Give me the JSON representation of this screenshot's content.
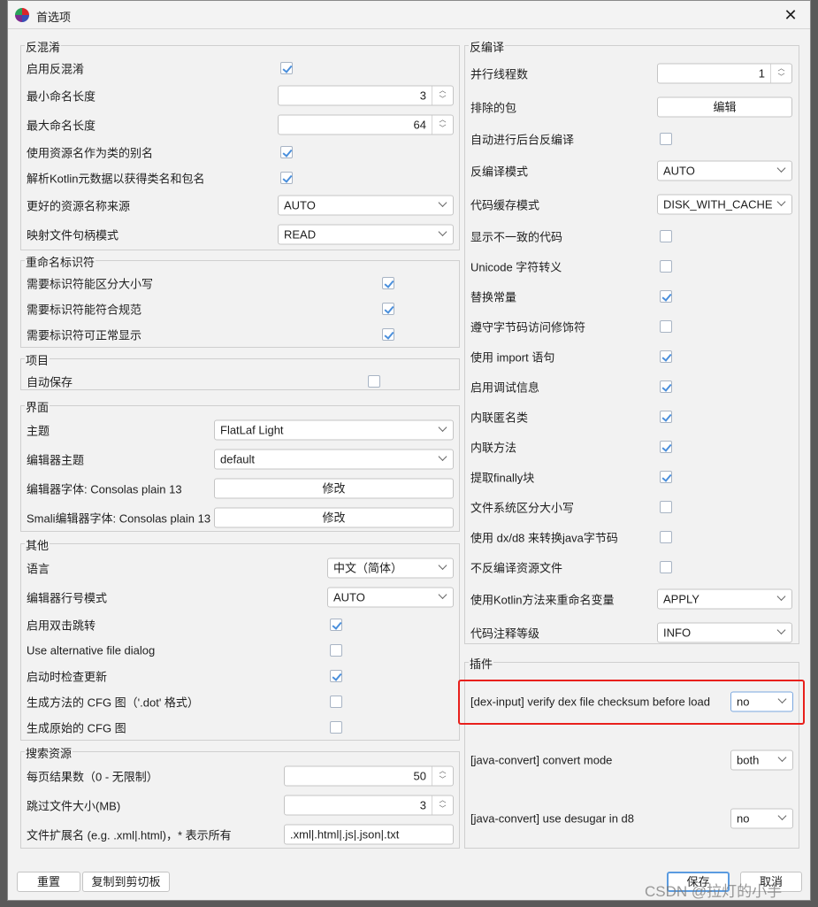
{
  "window": {
    "title": "首选项",
    "close_icon": "close-icon",
    "app_icon": "jadx-logo-icon"
  },
  "accent_color": "#4a8fdc",
  "highlight_color": "#e8201c",
  "groups": [
    {
      "id": "deobfuscation",
      "title": "反混淆",
      "rows": [
        {
          "label": "启用反混淆",
          "type": "check",
          "checked": true
        },
        {
          "label": "最小命名长度",
          "type": "spin",
          "value": "3"
        },
        {
          "label": "最大命名长度",
          "type": "spin",
          "value": "64"
        },
        {
          "label": "使用资源名作为类的别名",
          "type": "check",
          "checked": true
        },
        {
          "label": "解析Kotlin元数据以获得类名和包名",
          "type": "check",
          "checked": true
        },
        {
          "label": "更好的资源名称来源",
          "type": "select",
          "value": "AUTO"
        },
        {
          "label": "映射文件句柄模式",
          "type": "select",
          "value": "READ"
        }
      ]
    },
    {
      "id": "rename",
      "title": "重命名标识符",
      "rows": [
        {
          "label": "需要标识符能区分大小写",
          "type": "check",
          "checked": true
        },
        {
          "label": "需要标识符能符合规范",
          "type": "check",
          "checked": true
        },
        {
          "label": "需要标识符可正常显示",
          "type": "check",
          "checked": true
        }
      ]
    },
    {
      "id": "project",
      "title": "项目",
      "rows": [
        {
          "label": "自动保存",
          "type": "check",
          "checked": false
        }
      ]
    },
    {
      "id": "ui",
      "title": "界面",
      "rows": [
        {
          "label": "主题",
          "type": "select",
          "value": "FlatLaf Light"
        },
        {
          "label": "编辑器主题",
          "type": "select",
          "value": "default"
        },
        {
          "label": "编辑器字体: Consolas plain 13",
          "type": "button",
          "value": "修改"
        },
        {
          "label": "Smali编辑器字体: Consolas plain 13",
          "type": "button",
          "value": "修改"
        }
      ]
    },
    {
      "id": "other",
      "title": "其他",
      "rows": [
        {
          "label": "语言",
          "type": "select",
          "value": "中文（简体）"
        },
        {
          "label": "编辑器行号模式",
          "type": "select",
          "value": "AUTO"
        },
        {
          "label": "启用双击跳转",
          "type": "check",
          "checked": true
        },
        {
          "label": "Use alternative file dialog",
          "type": "check",
          "checked": false
        },
        {
          "label": "启动时检查更新",
          "type": "check",
          "checked": true
        },
        {
          "label": "生成方法的 CFG 图（'.dot' 格式）",
          "type": "check",
          "checked": false
        },
        {
          "label": "生成原始的 CFG 图",
          "type": "check",
          "checked": false
        }
      ]
    },
    {
      "id": "search",
      "title": "搜索资源",
      "rows": [
        {
          "label": "每页结果数（0 - 无限制）",
          "type": "spin",
          "value": "50"
        },
        {
          "label": "跳过文件大小(MB)",
          "type": "spin",
          "value": "3"
        },
        {
          "label": "文件扩展名 (e.g. .xml|.html)，* 表示所有",
          "type": "text",
          "value": ".xml|.html|.js|.json|.txt"
        }
      ]
    },
    {
      "id": "decompilation",
      "title": "反编译",
      "rows": [
        {
          "label": "并行线程数",
          "type": "spin",
          "value": "1"
        },
        {
          "label": "排除的包",
          "type": "button",
          "value": "编辑"
        },
        {
          "label": "自动进行后台反编译",
          "type": "check",
          "checked": false
        },
        {
          "label": "反编译模式",
          "type": "select",
          "value": "AUTO"
        },
        {
          "label": "代码缓存模式",
          "type": "select",
          "value": "DISK_WITH_CACHE"
        },
        {
          "label": "显示不一致的代码",
          "type": "check",
          "checked": false
        },
        {
          "label": "Unicode 字符转义",
          "type": "check",
          "checked": false
        },
        {
          "label": "替换常量",
          "type": "check",
          "checked": true
        },
        {
          "label": "遵守字节码访问修饰符",
          "type": "check",
          "checked": false
        },
        {
          "label": "使用 import 语句",
          "type": "check",
          "checked": true
        },
        {
          "label": "启用调试信息",
          "type": "check",
          "checked": true
        },
        {
          "label": "内联匿名类",
          "type": "check",
          "checked": true
        },
        {
          "label": "内联方法",
          "type": "check",
          "checked": true
        },
        {
          "label": "提取finally块",
          "type": "check",
          "checked": true
        },
        {
          "label": "文件系统区分大小写",
          "type": "check",
          "checked": false
        },
        {
          "label": "使用 dx/d8 来转换java字节码",
          "type": "check",
          "checked": false
        },
        {
          "label": "不反编译资源文件",
          "type": "check",
          "checked": false
        },
        {
          "label": "使用Kotlin方法来重命名变量",
          "type": "select",
          "value": "APPLY"
        },
        {
          "label": "代码注释等级",
          "type": "select",
          "value": "INFO"
        }
      ]
    },
    {
      "id": "plugins",
      "title": "插件",
      "rows": [
        {
          "label": "[dex-input]  verify dex file checksum before load",
          "type": "select",
          "value": "no",
          "focused": true
        },
        {
          "label": "[java-convert]  convert mode",
          "type": "select",
          "value": "both"
        },
        {
          "label": "[java-convert]  use desugar in d8",
          "type": "select",
          "value": "no"
        }
      ]
    }
  ],
  "footer": {
    "reset": "重置",
    "copy": "复制到剪切板",
    "save": "保存",
    "cancel": "取消"
  },
  "watermark": "CSDN @拉灯的小手"
}
